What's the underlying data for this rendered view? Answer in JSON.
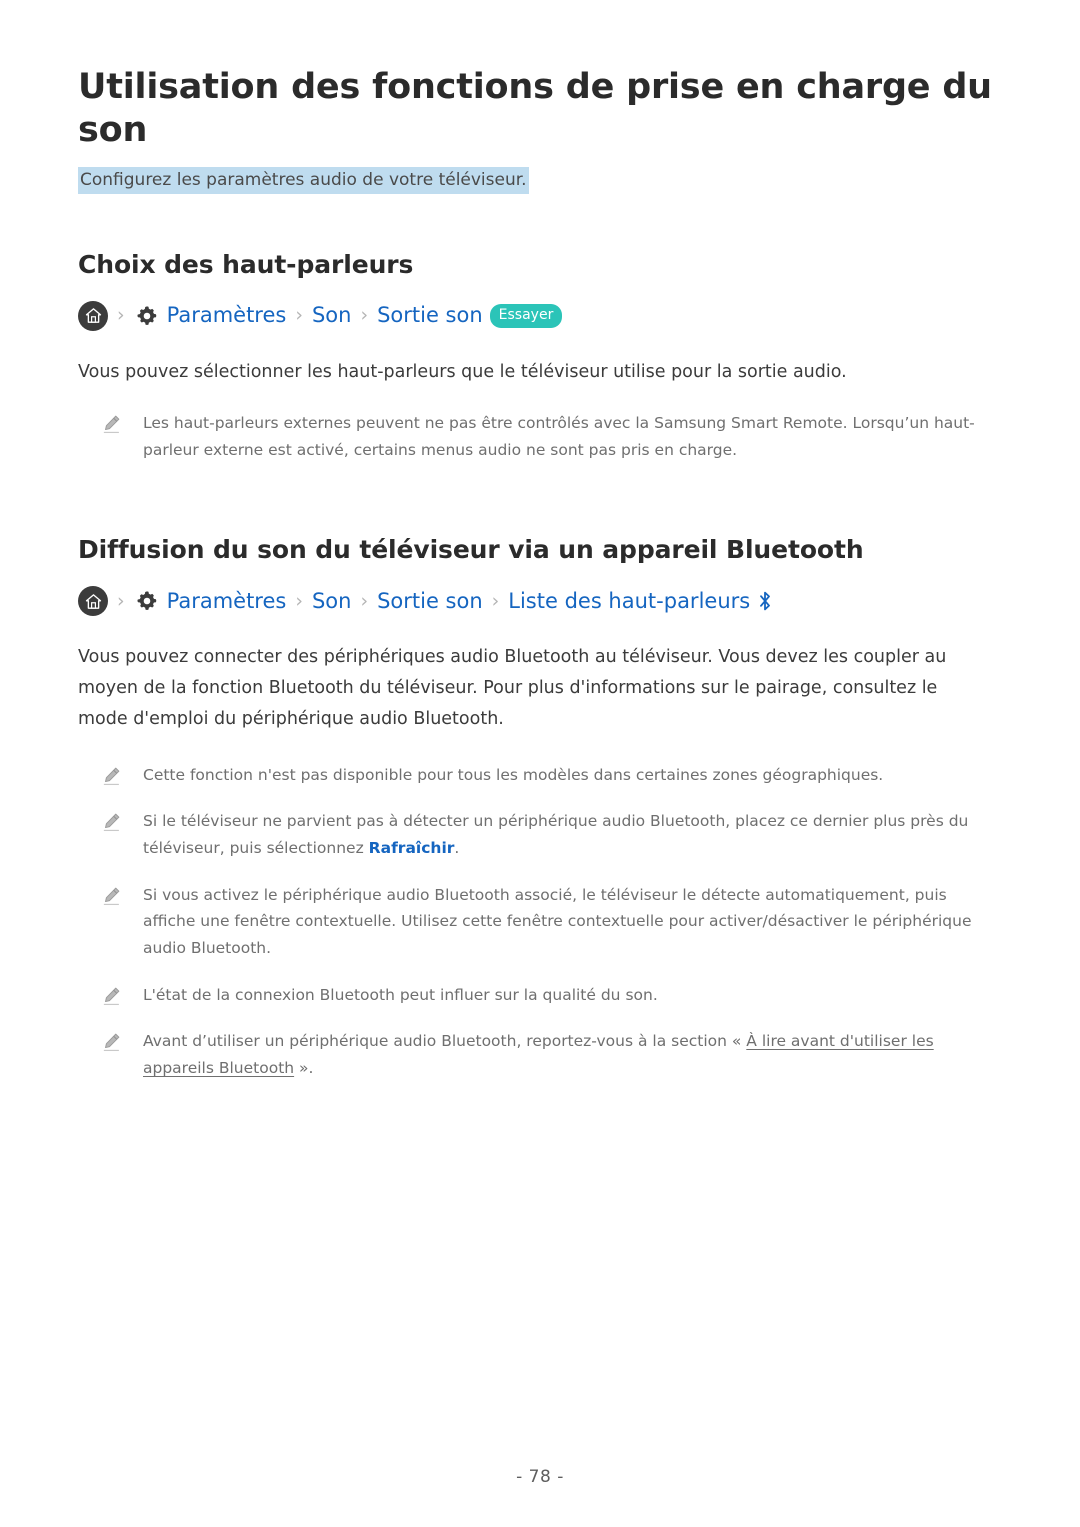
{
  "document": {
    "title": "Utilisation des fonctions de prise en charge du son",
    "subtitle": "Configurez les paramètres audio de votre téléviseur.",
    "page_number": "- 78 -"
  },
  "colors": {
    "link_blue": "#1565c0",
    "badge_teal": "#2bc4b8",
    "highlight_blue": "#bfdcef",
    "note_gray": "#6f6f6f",
    "home_circle": "#3c3c3c"
  },
  "sections": [
    {
      "heading": "Choix des haut-parleurs",
      "breadcrumb": {
        "home_icon": "home-icon",
        "gear_icon": "gear-icon",
        "separator": "›",
        "crumbs": [
          "Paramètres",
          "Son",
          "Sortie son"
        ],
        "badge": "Essayer"
      },
      "body": "Vous pouvez sélectionner les haut-parleurs que le téléviseur utilise pour la sortie audio.",
      "notes": [
        {
          "icon": "pencil-icon",
          "text": "Les haut-parleurs externes peuvent ne pas être contrôlés avec la Samsung Smart Remote. Lorsqu’un haut-parleur externe est activé, certains menus audio ne sont pas pris en charge."
        }
      ]
    },
    {
      "heading": "Diffusion du son du téléviseur via un appareil Bluetooth",
      "breadcrumb": {
        "home_icon": "home-icon",
        "gear_icon": "gear-icon",
        "separator": "›",
        "crumbs": [
          "Paramètres",
          "Son",
          "Sortie son",
          "Liste des haut-parleurs"
        ],
        "bluetooth_icon": "bluetooth-icon"
      },
      "body": "Vous pouvez connecter des périphériques audio Bluetooth au téléviseur. Vous devez les coupler au moyen de la fonction Bluetooth du téléviseur. Pour plus d'informations sur le pairage, consultez le mode d'emploi du périphérique audio Bluetooth.",
      "notes": [
        {
          "icon": "pencil-icon",
          "text": "Cette fonction n'est pas disponible pour tous les modèles dans certaines zones géographiques."
        },
        {
          "icon": "pencil-icon",
          "text_before": "Si le téléviseur ne parvient pas à détecter un périphérique audio Bluetooth, placez ce dernier plus près du téléviseur, puis sélectionnez ",
          "link": "Rafraîchir",
          "text_after": "."
        },
        {
          "icon": "pencil-icon",
          "text": "Si vous activez le périphérique audio Bluetooth associé, le téléviseur le détecte automatiquement, puis affiche une fenêtre contextuelle. Utilisez cette fenêtre contextuelle pour activer/désactiver le périphérique audio Bluetooth."
        },
        {
          "icon": "pencil-icon",
          "text": "L'état de la connexion Bluetooth peut influer sur la qualité du son."
        },
        {
          "icon": "pencil-icon",
          "text_before": "Avant d’utiliser un périphérique audio Bluetooth, reportez-vous à la section « ",
          "xref": "À lire avant d'utiliser les appareils Bluetooth",
          "text_after": " »."
        }
      ]
    }
  ]
}
